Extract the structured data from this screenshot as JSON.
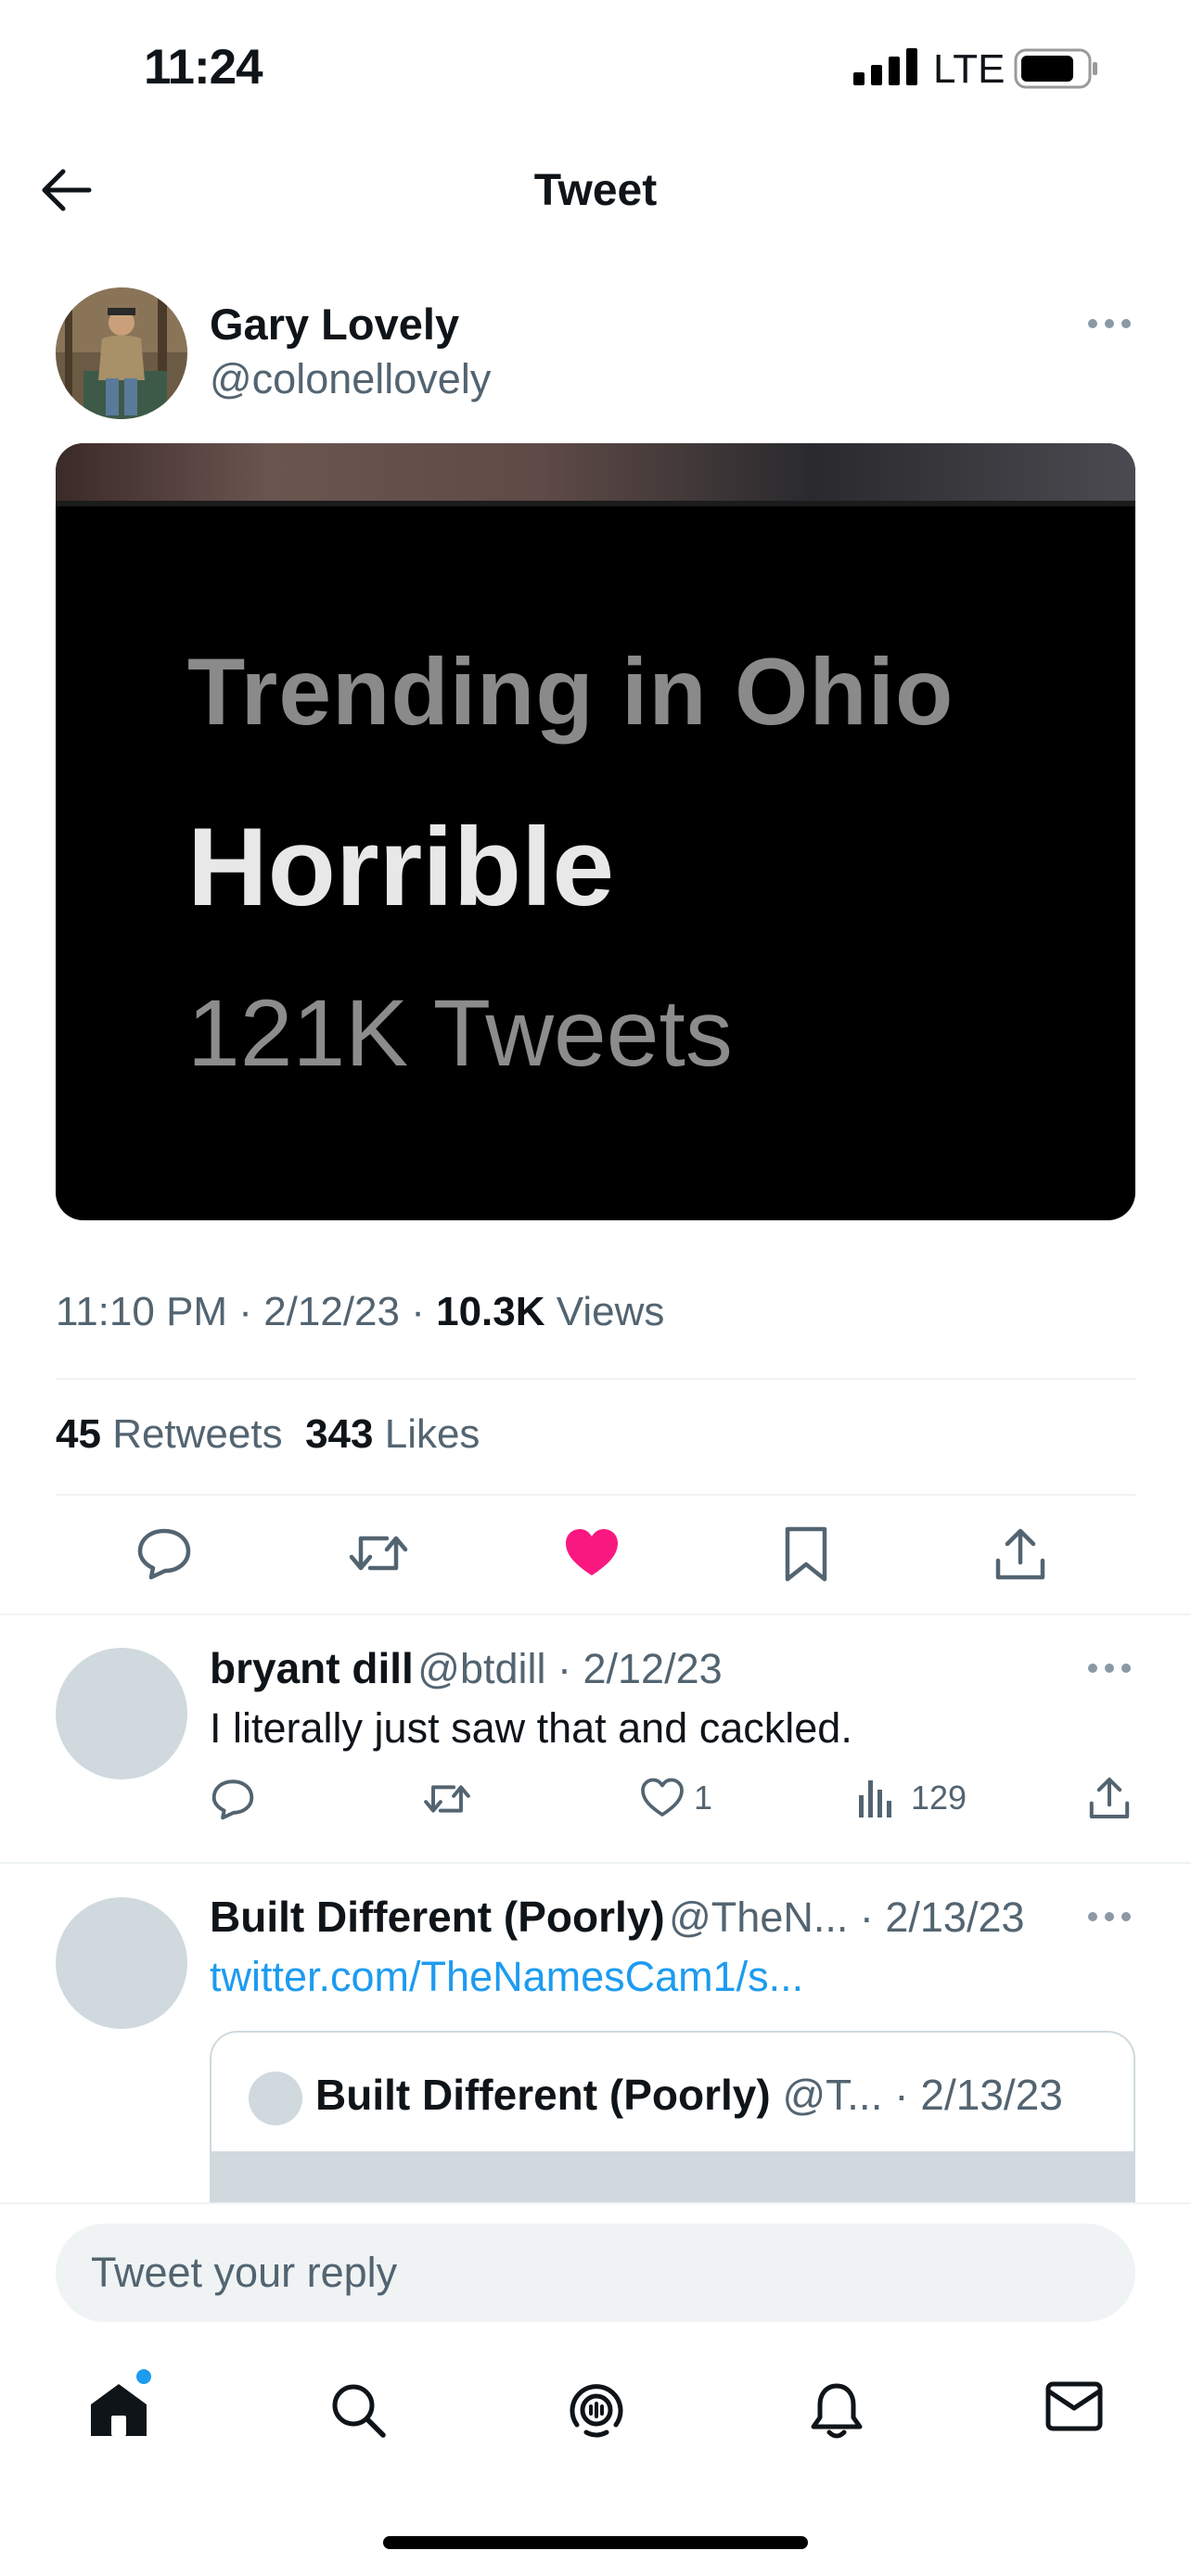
{
  "status_bar": {
    "time": "11:24",
    "network": "LTE"
  },
  "header": {
    "title": "Tweet"
  },
  "tweet": {
    "author_name": "Gary Lovely",
    "author_handle": "@colonellovely",
    "media": {
      "line1": "Trending in Ohio",
      "line2": "Horrible",
      "line3": "121K Tweets"
    },
    "time": "11:10 PM",
    "date": "2/12/23",
    "views_count": "10.3K",
    "views_label": "Views",
    "retweets_count": "45",
    "retweets_label": "Retweets",
    "likes_count": "343",
    "likes_label": "Likes",
    "liked": true,
    "like_color": "#f91880"
  },
  "replies": [
    {
      "name": "bryant dill",
      "handle": "@btdill",
      "date": "2/12/23",
      "text": "I literally just saw that and cackled.",
      "likes": "1",
      "views": "129"
    },
    {
      "name": "Built Different (Poorly)",
      "handle": "@TheN...",
      "date": "2/13/23",
      "link": "twitter.com/TheNamesCam1/s...",
      "quote": {
        "name": "Built Different (Poorly)",
        "handle": "@T...",
        "date": "2/13/23"
      }
    }
  ],
  "reply_bar": {
    "placeholder": "Tweet your reply"
  },
  "tab_bar": {
    "items": [
      "home-icon",
      "search-icon",
      "spaces-icon",
      "notifications-icon",
      "messages-icon"
    ],
    "home_has_unread": true,
    "accent": "#1d9bf0"
  },
  "colors": {
    "text": "#0f1419",
    "secondary": "#536471",
    "link": "#1d9bf0",
    "like": "#f91880"
  }
}
